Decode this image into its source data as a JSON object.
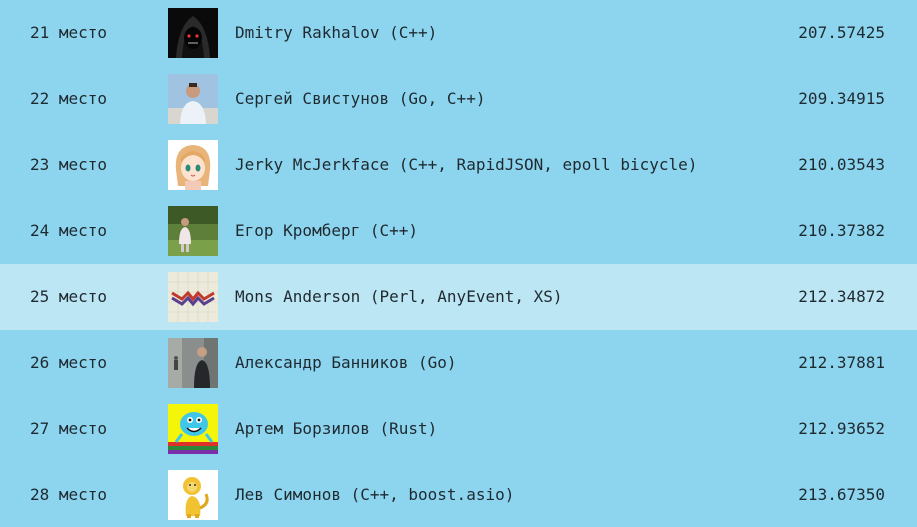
{
  "leaderboard": {
    "rows": [
      {
        "place": "21 место",
        "name": "Dmitry Rakhalov (C++)",
        "score": "207.57425",
        "avatar": "hooded-figure-avatar-icon",
        "highlighted": false
      },
      {
        "place": "22 место",
        "name": "Сергей Свистунов (Go, C++)",
        "score": "209.34915",
        "avatar": "person-photo-avatar-icon",
        "highlighted": false
      },
      {
        "place": "23 место",
        "name": "Jerky McJerkface (C++, RapidJSON, epoll bicycle)",
        "score": "210.03543",
        "avatar": "anime-girl-avatar-icon",
        "highlighted": false
      },
      {
        "place": "24 место",
        "name": "Егор Кромберг (C++)",
        "score": "210.37382",
        "avatar": "person-outdoors-avatar-icon",
        "highlighted": false
      },
      {
        "place": "25 место",
        "name": "Mons Anderson (Perl, AnyEvent, XS)",
        "score": "212.34872",
        "avatar": "wave-logo-avatar-icon",
        "highlighted": true
      },
      {
        "place": "26 место",
        "name": "Александр Банников (Go)",
        "score": "212.37881",
        "avatar": "person-street-avatar-icon",
        "highlighted": false
      },
      {
        "place": "27 место",
        "name": "Артем Борзилов (Rust)",
        "score": "212.93652",
        "avatar": "cartoon-monster-avatar-icon",
        "highlighted": false
      },
      {
        "place": "28 место",
        "name": "Лев Симонов (C++, boost.asio)",
        "score": "213.67350",
        "avatar": "cartoon-lion-avatar-icon",
        "highlighted": false
      }
    ]
  },
  "colors": {
    "background": "#8dd5ef",
    "highlight": "#bde6f4",
    "text": "#1f2a30"
  }
}
